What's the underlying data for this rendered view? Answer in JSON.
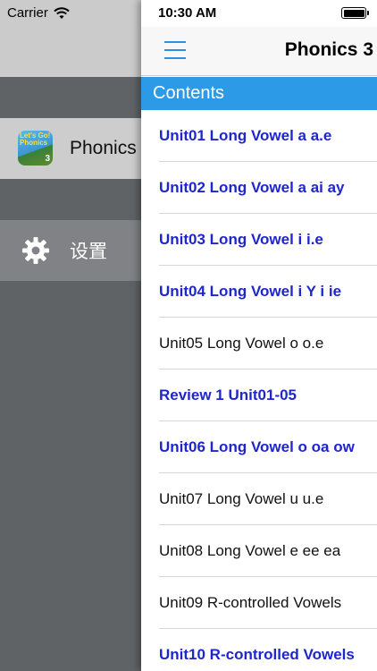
{
  "status_left": {
    "carrier": "Carrier"
  },
  "status_right": {
    "time": "10:30 AM"
  },
  "side_menu": {
    "items": [
      {
        "label": "Phonics",
        "icon": "app-icon",
        "icon_text": "Let's Go! Phonics",
        "icon_number": "3"
      },
      {
        "label": "设置",
        "icon": "gear-icon"
      }
    ]
  },
  "panel": {
    "title": "Phonics 3",
    "section_header": "Contents",
    "colors": {
      "accent": "#2d9ae8",
      "link_blue": "#1f26cc",
      "text": "#111111"
    },
    "units": [
      {
        "label": "Unit01 Long Vowel a a.e",
        "style": "blue"
      },
      {
        "label": "Unit02 Long Vowel a ai ay",
        "style": "blue"
      },
      {
        "label": "Unit03 Long Vowel i i.e",
        "style": "blue"
      },
      {
        "label": "Unit04 Long Vowel i Y i ie",
        "style": "blue"
      },
      {
        "label": "Unit05 Long Vowel o o.e",
        "style": "black"
      },
      {
        "label": "Review 1 Unit01-05",
        "style": "blue"
      },
      {
        "label": "Unit06 Long Vowel o oa ow",
        "style": "blue"
      },
      {
        "label": "Unit07 Long Vowel u u.e",
        "style": "black"
      },
      {
        "label": "Unit08 Long Vowel e ee ea",
        "style": "black"
      },
      {
        "label": "Unit09 R-controlled Vowels",
        "style": "black"
      },
      {
        "label": "Unit10 R-controlled Vowels",
        "style": "blue"
      }
    ]
  }
}
